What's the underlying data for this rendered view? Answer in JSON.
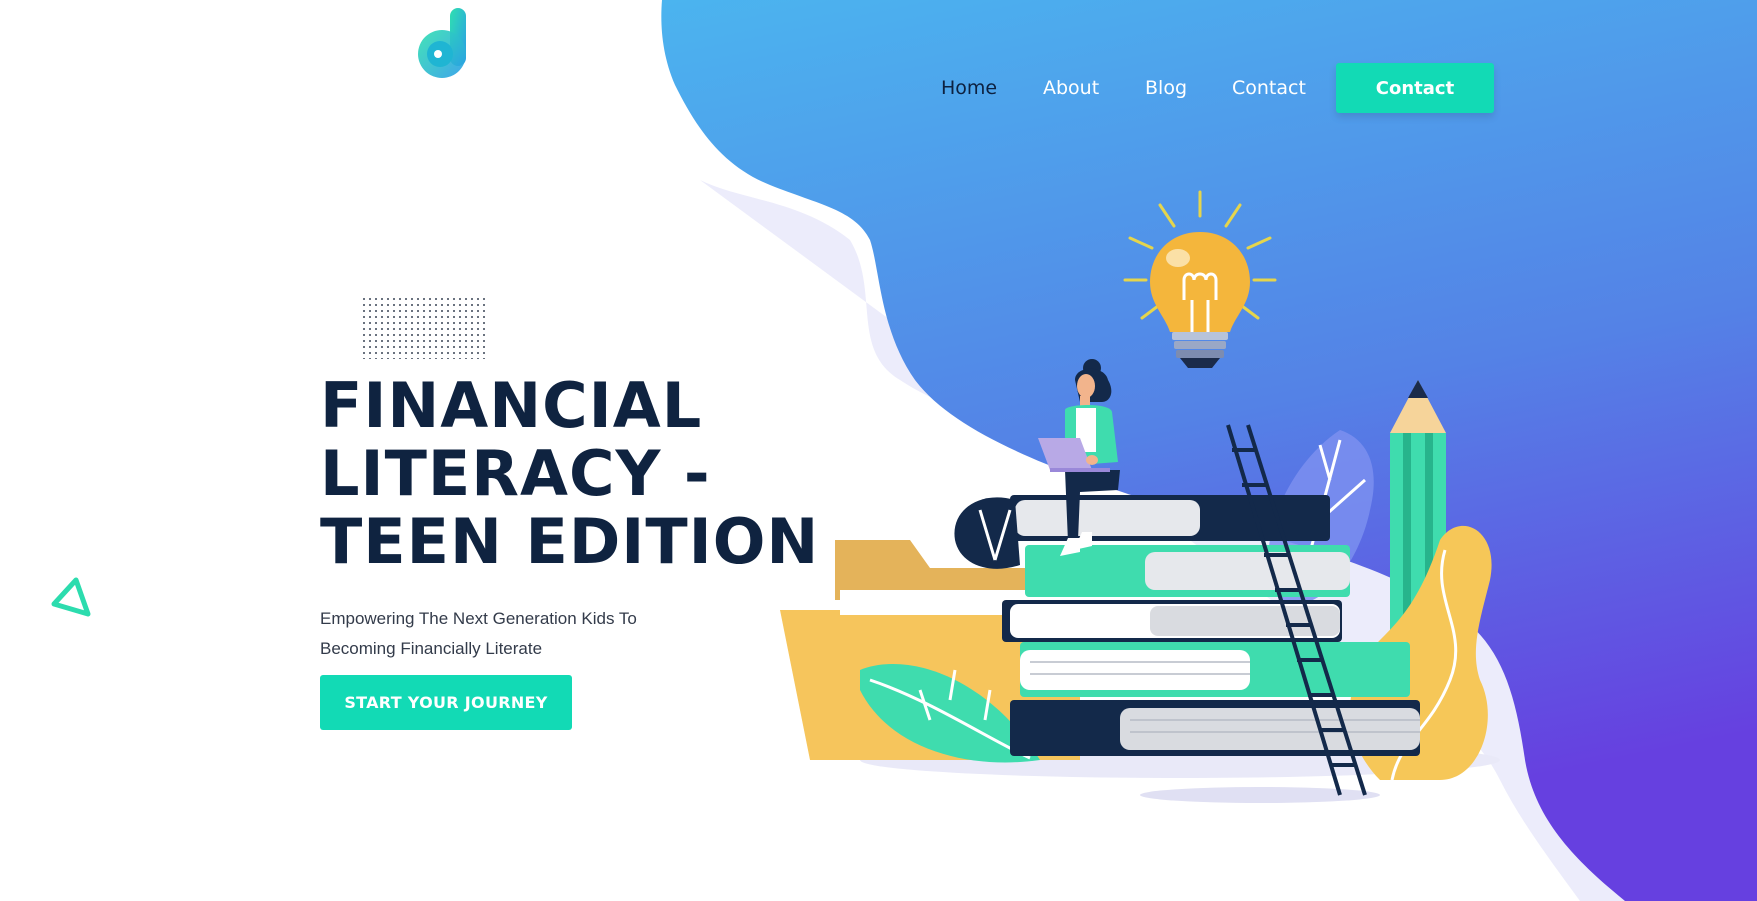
{
  "nav": {
    "links": [
      {
        "label": "Home",
        "active": true
      },
      {
        "label": "About"
      },
      {
        "label": "Blog"
      },
      {
        "label": "Contact"
      }
    ],
    "cta_label": "Contact"
  },
  "hero": {
    "title_lines": [
      "FINANCIAL",
      "LITERACY -",
      "TEEN EDITION"
    ],
    "subtitle_lines": [
      "Empowering The Next Generation Kids To",
      "Becoming Financially Literate"
    ],
    "cta_label": "START YOUR JOURNEY"
  },
  "colors": {
    "accent": "#12dab5",
    "heading": "#0f2340",
    "blob_top": "#4bb4ef",
    "blob_bottom": "#6640e0"
  },
  "icons": [
    "logo-icon",
    "lightbulb-icon",
    "pencil-icon",
    "ladder-icon",
    "leaf-icon",
    "folder-icon",
    "books-icon",
    "laptop-icon"
  ]
}
